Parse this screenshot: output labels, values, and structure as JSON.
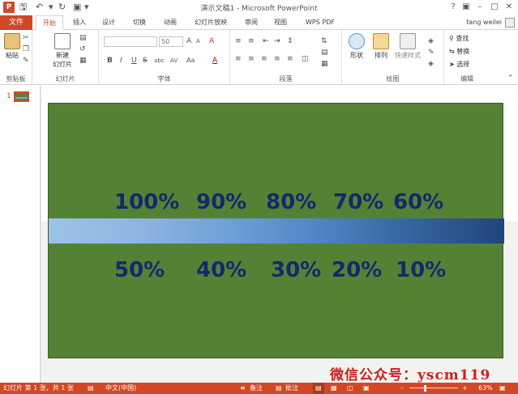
{
  "titlebar": {
    "app_icon": "P",
    "title": "演示文稿1 - Microsoft PowerPoint",
    "help": "?",
    "restore": "▣",
    "minimize": "–",
    "maximize": "□",
    "close": "✕"
  },
  "tabs": {
    "file": "文件",
    "items": [
      "开始",
      "插入",
      "设计",
      "切换",
      "动画",
      "幻灯片放映",
      "审阅",
      "视图",
      "WPS PDF"
    ],
    "active_index": 0,
    "user": "tang weilei"
  },
  "ribbon": {
    "clipboard": {
      "paste": "粘贴",
      "label": "剪贴板"
    },
    "slides": {
      "new_slide_line1": "新建",
      "new_slide_line2": "幻灯片",
      "label": "幻灯片"
    },
    "font": {
      "size": "50",
      "label": "字体",
      "bold": "B",
      "italic": "I",
      "underline": "U",
      "strike": "S",
      "shadow": "abc",
      "spacing": "AV",
      "case": "Aa",
      "grow": "A",
      "shrink": "A",
      "clear": "A"
    },
    "paragraph": {
      "label": "段落"
    },
    "drawing": {
      "shapes": "形状",
      "arrange": "排列",
      "quick_styles": "快速样式",
      "label": "绘图"
    },
    "editing": {
      "find": "查找",
      "replace": "替换",
      "select": "选择",
      "label": "编辑"
    }
  },
  "thumbs": {
    "number": "1"
  },
  "slide": {
    "top_row": [
      "100%",
      "90%",
      "80%",
      "70%",
      "60%"
    ],
    "bottom_row": [
      "50%",
      "40%",
      "30%",
      "20%",
      "10%"
    ],
    "gradient_from": "#9dc3e6",
    "gradient_to": "#20467a",
    "background": "#548235",
    "text_color": "#102a6e"
  },
  "statusbar": {
    "slide_info": "幻灯片 第 1 张，共 1 张",
    "language": "中文(中国)",
    "notes": "备注",
    "comments": "批注",
    "zoom": "63%",
    "watermark": "微信公众号：yscm119"
  }
}
